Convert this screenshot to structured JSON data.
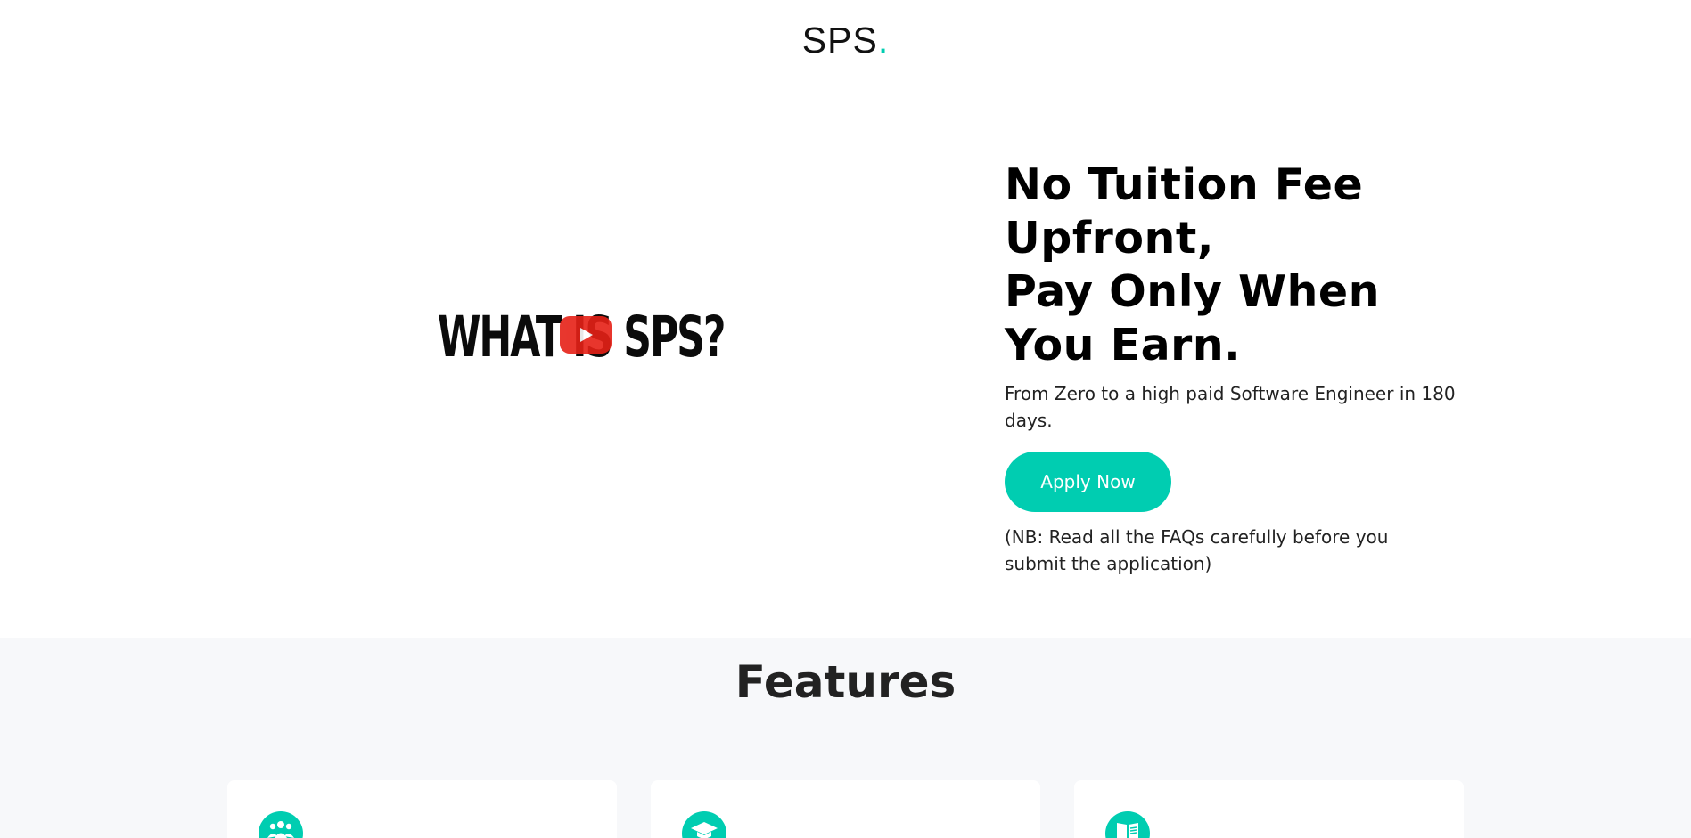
{
  "brand": {
    "name": "SPS",
    "dot": ".",
    "accent_color": "#00cdb1"
  },
  "hero": {
    "video": {
      "title_text": "WHAT IS SPS?",
      "play_icon": "youtube-play-icon",
      "play_color": "#e62117"
    },
    "headline_lines": [
      "No Tuition Fee",
      "Upfront,",
      "Pay Only When",
      "You Earn."
    ],
    "subtext": "From Zero to a high paid Software Engineer in 180 days.",
    "cta_label": "Apply Now",
    "note": "(NB: Read all the FAQs carefully before you submit the application)"
  },
  "features": {
    "title": "Features",
    "cards": [
      {
        "icon": "users-icon"
      },
      {
        "icon": "graduation-cap-icon"
      },
      {
        "icon": "book-icon"
      }
    ]
  }
}
